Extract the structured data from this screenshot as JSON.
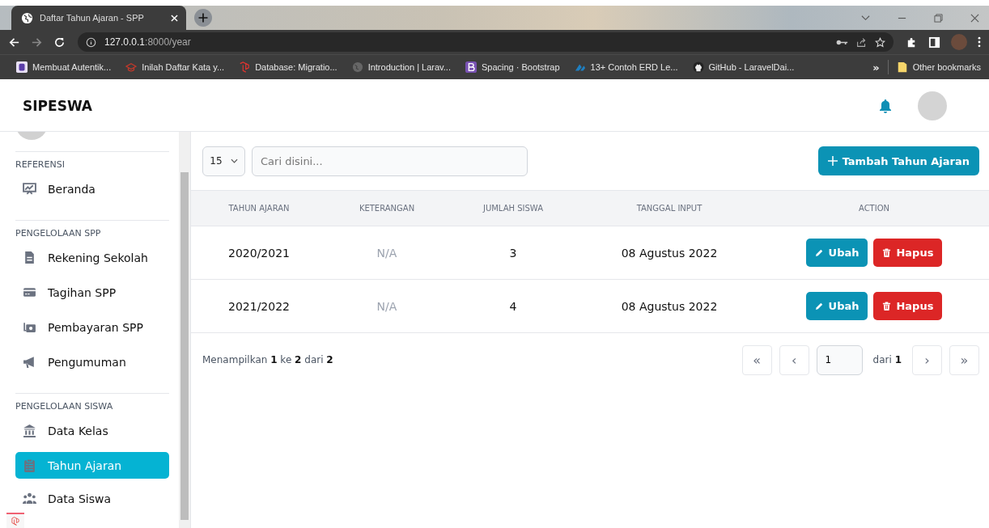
{
  "browser": {
    "tab_title": "Daftar Tahun Ajaran - SPP",
    "url_host": "127.0.0.1",
    "url_path": ":8000/year",
    "bookmarks": [
      {
        "label": "Membuat Autentik..."
      },
      {
        "label": "Inilah Daftar Kata y..."
      },
      {
        "label": "Database: Migratio..."
      },
      {
        "label": "Introduction | Larav..."
      },
      {
        "label": "Spacing · Bootstrap"
      },
      {
        "label": "13+ Contoh ERD Le..."
      },
      {
        "label": "GitHub - LaravelDai..."
      }
    ],
    "more": "»",
    "other_bookmarks": "Other bookmarks"
  },
  "app": {
    "brand": "SIPESWA"
  },
  "sidebar": {
    "sections": [
      {
        "title": "REFERENSI",
        "items": [
          {
            "label": "Beranda",
            "selected": false
          }
        ]
      },
      {
        "title": "PENGELOLAAN SPP",
        "items": [
          {
            "label": "Rekening Sekolah",
            "selected": false
          },
          {
            "label": "Tagihan SPP",
            "selected": false
          },
          {
            "label": "Pembayaran SPP",
            "selected": false
          },
          {
            "label": "Pengumuman",
            "selected": false
          }
        ]
      },
      {
        "title": "PENGELOLAAN SISWA",
        "items": [
          {
            "label": "Data Kelas",
            "selected": false
          },
          {
            "label": "Tahun Ajaran",
            "selected": true
          },
          {
            "label": "Data Siswa",
            "selected": false
          }
        ]
      }
    ]
  },
  "toolbar": {
    "page_size": "15",
    "search": {
      "placeholder": "Cari disini..."
    },
    "add_button": "Tambah Tahun Ajaran"
  },
  "table": {
    "columns": [
      "TAHUN AJARAN",
      "KETERANGAN",
      "JUMLAH SISWA",
      "TANGGAL INPUT",
      "ACTION"
    ],
    "rows": [
      {
        "tahun_ajaran": "2020/2021",
        "keterangan": "N/A",
        "jumlah_siswa": "3",
        "tanggal_input": "08 Agustus 2022",
        "edit": "Ubah",
        "delete": "Hapus"
      },
      {
        "tahun_ajaran": "2021/2022",
        "keterangan": "N/A",
        "jumlah_siswa": "4",
        "tanggal_input": "08 Agustus 2022",
        "edit": "Ubah",
        "delete": "Hapus"
      }
    ]
  },
  "footer": {
    "summary": "Menampilkan **1** ke **2** dari **2**",
    "first": "«",
    "prev": "‹",
    "page": "1",
    "page_total": "dari **1**",
    "next": "›",
    "last": "»"
  }
}
